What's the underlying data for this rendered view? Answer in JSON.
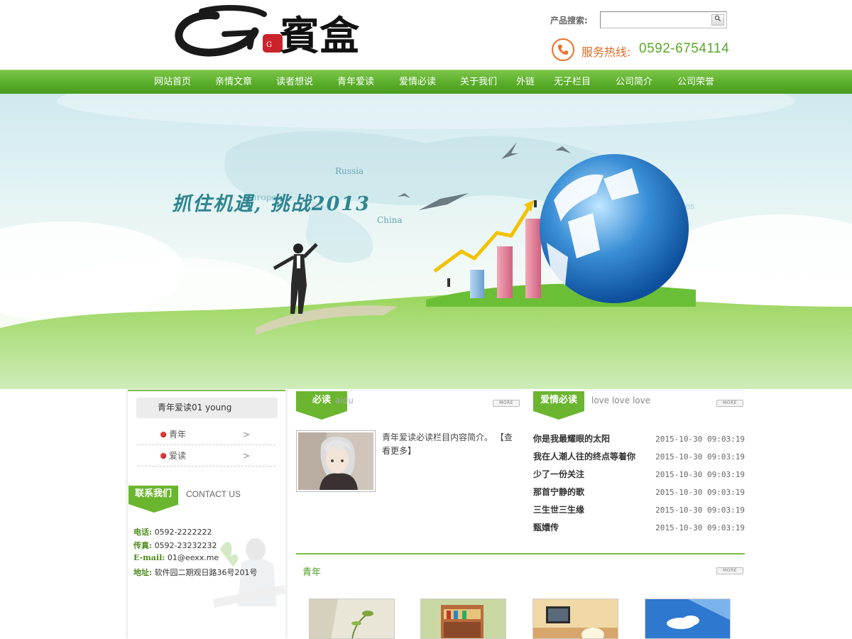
{
  "header": {
    "logo_text": "G賓盒",
    "search_label": "产品搜索:",
    "search_value": "",
    "search_button_icon": "magnifier-icon",
    "hotline_label": "服务热线:",
    "hotline_number": "0592-6754114"
  },
  "nav": {
    "items": [
      {
        "label": "网站首页"
      },
      {
        "label": "亲情文章"
      },
      {
        "label": "读者想说"
      },
      {
        "label": "青年爱读"
      },
      {
        "label": "爱情必读"
      },
      {
        "label": "关于我们"
      },
      {
        "label": "外链"
      },
      {
        "label": "无子栏目"
      },
      {
        "label": "公司简介"
      },
      {
        "label": "公司荣誉"
      }
    ]
  },
  "banner": {
    "slogan": "抓住机遇, 挑战2013",
    "map_labels": [
      "Russia",
      "Europe",
      "China",
      "States"
    ]
  },
  "sidebar": {
    "category_title": "青年爱读01 young",
    "categories": [
      {
        "label": "青年",
        "arrow": ">"
      },
      {
        "label": "爱读",
        "arrow": ">"
      }
    ],
    "contact_tab": "联系我们",
    "contact_en": "CONTACT US",
    "contact": {
      "phone_label": "电话:",
      "phone": "0592-2222222",
      "fax_label": "传真:",
      "fax": "0592-23232232",
      "email_label": "E-mail:",
      "email": "01@eexx.me",
      "address_label": "地址:",
      "address": "软件园二期观日路36号201号"
    }
  },
  "bidu": {
    "tab": "必读",
    "sub": "aidu",
    "more": "MORE",
    "intro": "青年爱读必读栏目内容简介。 【查看更多】"
  },
  "love": {
    "tab": "爱情必读",
    "sub": "love love love",
    "more": "MORE",
    "articles": [
      {
        "title": "你是我最耀眼的太阳",
        "date": "2015-10-30 09:03:19"
      },
      {
        "title": "我在人潮人往的终点等着你",
        "date": "2015-10-30 09:03:19"
      },
      {
        "title": "少了一份关注",
        "date": "2015-10-30 09:03:19"
      },
      {
        "title": "那首宁静的歌",
        "date": "2015-10-30 09:03:19"
      },
      {
        "title": "三生世三生缘",
        "date": "2015-10-30 09:03:19"
      },
      {
        "title": "甄嬛传",
        "date": "2015-10-30 09:03:19"
      }
    ]
  },
  "young": {
    "title": "青年",
    "more": "MORE"
  },
  "colors": {
    "nav_green": "#5aae2a",
    "accent_green": "#6bb52f",
    "hotline_orange": "#e06a22"
  }
}
